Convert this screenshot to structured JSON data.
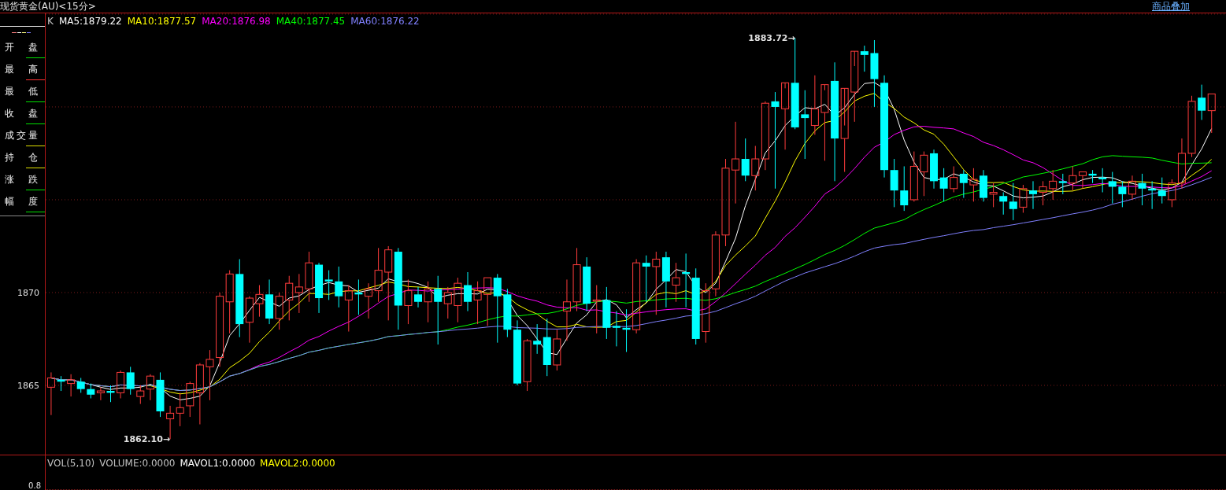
{
  "header": {
    "title": "现货黄金(AU)<15分>",
    "link": "商品叠加"
  },
  "legend": {
    "items": [
      {
        "label": "开盘",
        "color": "#00e000"
      },
      {
        "label": "最高",
        "color": "#ff3232"
      },
      {
        "label": "最低",
        "color": "#00e000"
      },
      {
        "label": "收盘",
        "color": "#00e000"
      },
      {
        "label": "成交量",
        "color": "#e0e000"
      },
      {
        "label": "持仓",
        "color": "#e0e000"
      },
      {
        "label": "涨跌",
        "color": "#00e000"
      },
      {
        "label": "幅度",
        "color": "#00e000"
      }
    ]
  },
  "price_pane": {
    "indicators": [
      {
        "text": "K",
        "color": "#c0c0c0"
      },
      {
        "text": "MA5:1879.22",
        "color": "#ffffff"
      },
      {
        "text": "MA10:1877.57",
        "color": "#ffff00"
      },
      {
        "text": "MA20:1876.98",
        "color": "#ff00ff"
      },
      {
        "text": "MA40:1877.45",
        "color": "#00ff00"
      },
      {
        "text": "MA60:1876.22",
        "color": "#8080ff"
      }
    ],
    "axis_labels": [
      "1870",
      "1865"
    ],
    "annotations": [
      {
        "text": "1883.72→",
        "kind": "high"
      },
      {
        "text": "1862.10→",
        "kind": "low"
      }
    ]
  },
  "volume_pane": {
    "indicators": [
      {
        "text": "VOL(5,10)",
        "color": "#c0c0c0"
      },
      {
        "text": "VOLUME:0.0000",
        "color": "#c0c0c0"
      },
      {
        "text": "MAVOL1:0.0000",
        "color": "#ffffff"
      },
      {
        "text": "MAVOL2:0.0000",
        "color": "#ffff00"
      }
    ],
    "axis_label": "0.8"
  }
}
